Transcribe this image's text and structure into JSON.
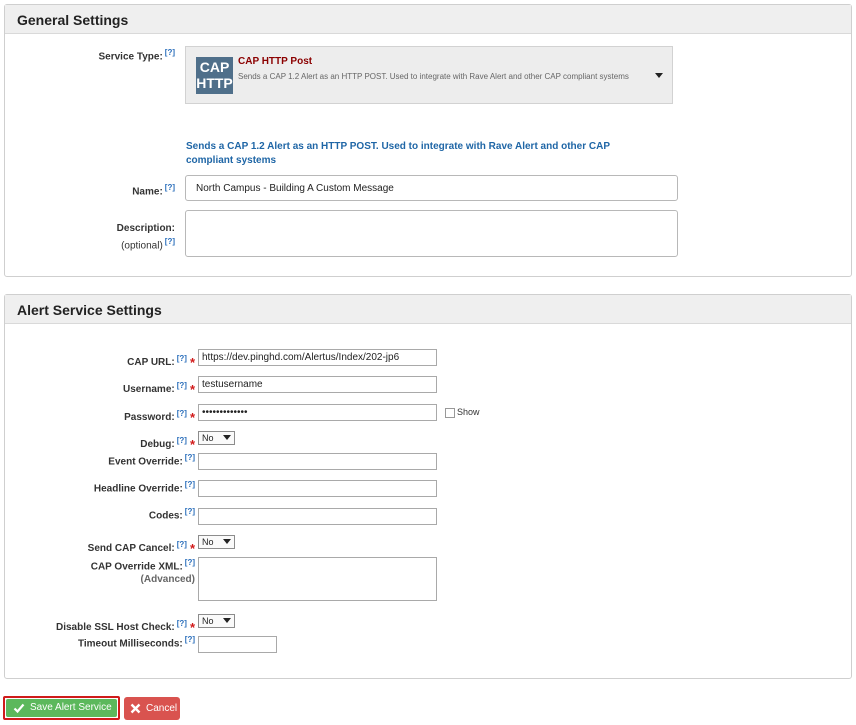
{
  "general": {
    "title": "General Settings",
    "service_type_label": "Service Type:",
    "help": "[?]",
    "service": {
      "icon_text_top": "CAP",
      "icon_text_bottom": "HTTP",
      "title": "CAP HTTP Post",
      "description": "Sends a CAP 1.2 Alert as an HTTP POST. Used to integrate with Rave Alert and other CAP compliant systems"
    },
    "info_text": "Sends a CAP 1.2 Alert as an HTTP POST. Used to integrate with Rave Alert and other CAP compliant systems",
    "name_label": "Name:",
    "name_value": "North Campus - Building A Custom Message",
    "description_label": "Description:",
    "description_sublabel": "(optional)",
    "description_value": ""
  },
  "alert": {
    "title": "Alert Service Settings",
    "required_mark": "*",
    "cap_url_label": "CAP URL:",
    "cap_url_value": "https://dev.pinghd.com/Alertus/Index/202-jp6",
    "username_label": "Username:",
    "username_value": "testusername",
    "password_label": "Password:",
    "password_value": "•••••••••••••",
    "show_label": "Show",
    "debug_label": "Debug:",
    "debug_value": "No",
    "event_override_label": "Event Override:",
    "event_override_value": "",
    "headline_override_label": "Headline Override:",
    "headline_override_value": "",
    "codes_label": "Codes:",
    "codes_value": "",
    "send_cap_cancel_label": "Send CAP Cancel:",
    "send_cap_cancel_value": "No",
    "cap_override_xml_label": "CAP Override XML:",
    "cap_override_xml_sublabel": "(Advanced)",
    "cap_override_xml_value": "",
    "disable_ssl_label": "Disable SSL Host Check:",
    "disable_ssl_value": "No",
    "timeout_label": "Timeout Milliseconds:",
    "timeout_value": ""
  },
  "buttons": {
    "save_label": "Save Alert Service",
    "cancel_label": "Cancel"
  },
  "icons": {
    "save": "checkmark-icon",
    "cancel": "x-icon"
  }
}
